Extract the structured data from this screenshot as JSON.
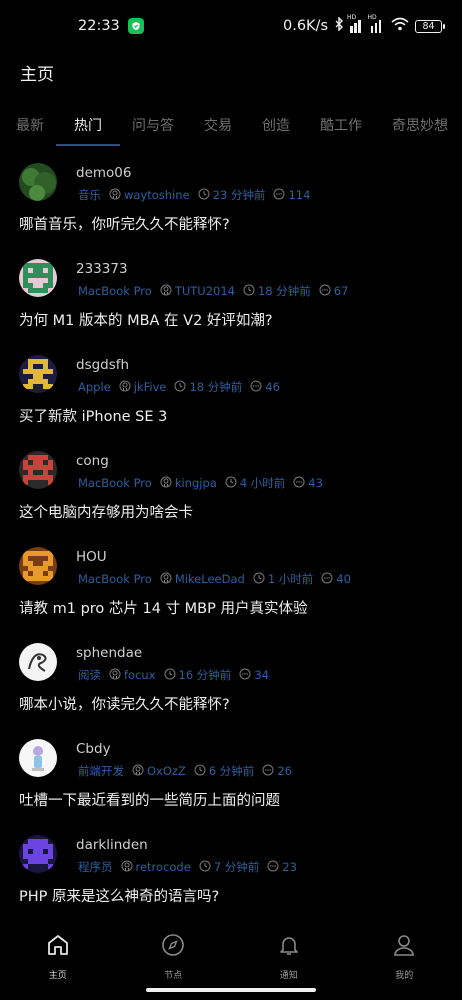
{
  "status_bar": {
    "time": "22:33",
    "net_speed": "0.6K/s",
    "battery": "84",
    "signal_label": "HD"
  },
  "header": {
    "title": "主页"
  },
  "tabs": [
    {
      "label": "最新",
      "active": false
    },
    {
      "label": "热门",
      "active": true
    },
    {
      "label": "问与答",
      "active": false
    },
    {
      "label": "交易",
      "active": false
    },
    {
      "label": "创造",
      "active": false
    },
    {
      "label": "酷工作",
      "active": false
    },
    {
      "label": "奇思妙想",
      "active": false
    }
  ],
  "topics": [
    {
      "username": "demo06",
      "node": "音乐",
      "author": "waytoshine",
      "time": "23 分钟前",
      "replies": "114",
      "title": "哪首音乐，你听完久久不能释怀?",
      "avatar": "green-photo"
    },
    {
      "username": "233373",
      "node": "MacBook Pro",
      "author": "TUTU2014",
      "time": "18 分钟前",
      "replies": "67",
      "title": "为何 M1 版本的 MBA 在 V2 好评如潮?",
      "avatar": "pixel-green"
    },
    {
      "username": "dsgdsfh",
      "node": "Apple",
      "author": "jkFive",
      "time": "18 分钟前",
      "replies": "46",
      "title": "买了新款 iPhone SE 3",
      "avatar": "pixel-yellow"
    },
    {
      "username": "cong",
      "node": "MacBook Pro",
      "author": "kingjpa",
      "time": "4 小时前",
      "replies": "43",
      "title": "这个电脑内存够用为啥会卡",
      "avatar": "pixel-red"
    },
    {
      "username": "HOU",
      "node": "MacBook Pro",
      "author": "MikeLeeDad",
      "time": "1 小时前",
      "replies": "40",
      "title": "请教 m1 pro 芯片 14 寸 MBP 用户真实体验",
      "avatar": "pixel-orange"
    },
    {
      "username": "sphendae",
      "node": "阅读",
      "author": "focux",
      "time": "16 分钟前",
      "replies": "34",
      "title": "哪本小说，你读完久久不能释怀?",
      "avatar": "white-sketch"
    },
    {
      "username": "Cbdy",
      "node": "前端开发",
      "author": "OxOzZ",
      "time": "6 分钟前",
      "replies": "26",
      "title": "吐槽一下最近看到的一些简历上面的问题",
      "avatar": "white-figure"
    },
    {
      "username": "darklinden",
      "node": "程序员",
      "author": "retrocode",
      "time": "7 分钟前",
      "replies": "23",
      "title": "PHP 原来是这么神奇的语言吗?",
      "avatar": "pixel-purple"
    }
  ],
  "bottom_nav": [
    {
      "label": "主页",
      "icon": "home-icon",
      "active": true
    },
    {
      "label": "节点",
      "icon": "compass-icon",
      "active": false
    },
    {
      "label": "通知",
      "icon": "bell-icon",
      "active": false
    },
    {
      "label": "我的",
      "icon": "user-icon",
      "active": false
    }
  ],
  "colors": {
    "background": "#000000",
    "meta_blue": "#2d5fa1",
    "tab_underline": "#2f4f7f"
  }
}
